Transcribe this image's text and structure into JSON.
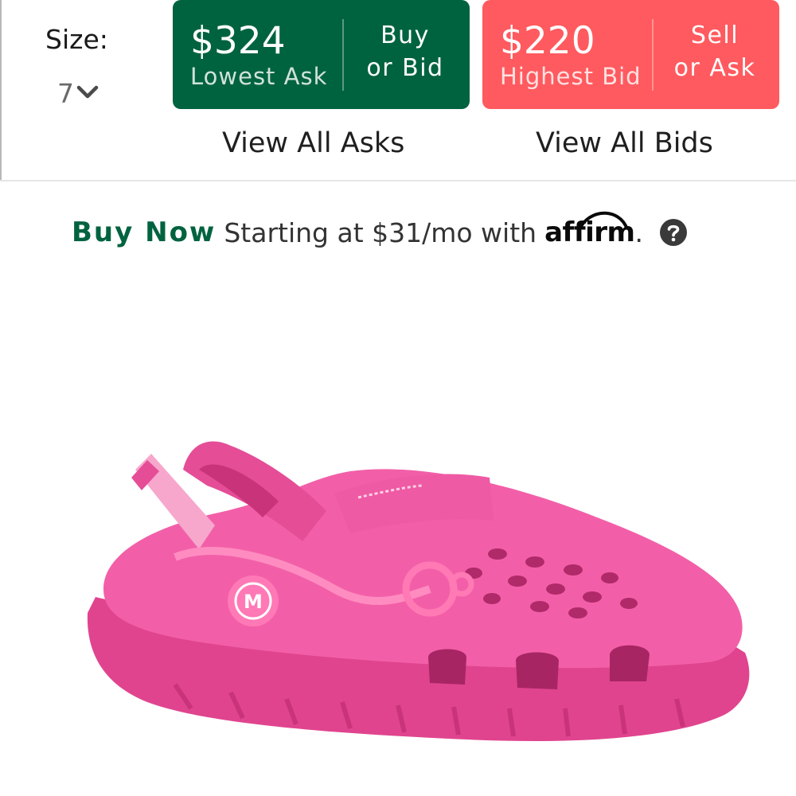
{
  "size": {
    "label": "Size:",
    "value": "7"
  },
  "buy": {
    "price": "$324",
    "caption": "Lowest Ask",
    "action_line1": "Buy",
    "action_line2": "or Bid"
  },
  "sell": {
    "price": "$220",
    "caption": "Highest Bid",
    "action_line1": "Sell",
    "action_line2": "or Ask"
  },
  "links": {
    "view_asks": "View All Asks",
    "view_bids": "View All Bids"
  },
  "financing": {
    "buy_now": "Buy Now",
    "text": "Starting at $31/mo with",
    "brand": "affirm",
    "trailing": ".",
    "help_icon": "question-circle-icon"
  },
  "product": {
    "badge_letter": "M",
    "image": "pink-clog-product-image"
  },
  "colors": {
    "buy_green": "#006340",
    "sell_red": "#ff5a5f",
    "product_pink": "#f25fa8"
  }
}
